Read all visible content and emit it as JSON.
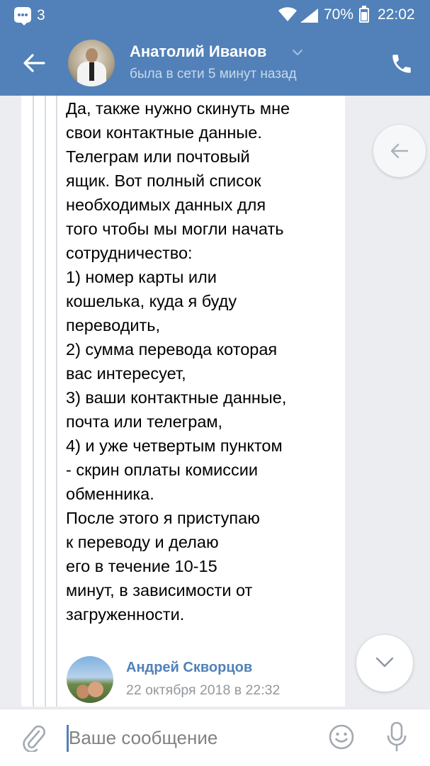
{
  "status_bar": {
    "notification_count": "3",
    "battery": "70%",
    "time": "22:02"
  },
  "header": {
    "contact_name": "Анатолий Иванов",
    "contact_status": "была в сети 5 минут назад"
  },
  "message": {
    "lines": [
      "Да, также нужно скинуть мне",
      "свои контактные данные.",
      "Телеграм или почтовый",
      "ящик. Вот полный список",
      "необходимых данных для",
      "того чтобы мы могли начать",
      "сотрудничество:",
      "1) номер карты или",
      "кошелька, куда я буду",
      "переводить,",
      "2) сумма перевода которая",
      "вас интересует,",
      "3) ваши контактные данные,",
      "почта или телеграм,",
      "4) и уже четвертым пунктом",
      "- скрин оплаты комиссии",
      "обменника.",
      "После этого я приступаю",
      "к переводу и делаю",
      "его в течение 10-15",
      "минут, в зависимости от",
      "загруженности."
    ],
    "forwarded_sender": "Андрей Скворцов",
    "forwarded_date": "22 октября 2018 в 22:32"
  },
  "composer": {
    "placeholder": "Ваше сообщение"
  },
  "colors": {
    "brand": "#5181b8",
    "background": "#ebedf0"
  },
  "icons": [
    "message-notification-icon",
    "wifi-icon",
    "signal-icon",
    "battery-icon",
    "back-arrow-icon",
    "chevron-down-icon",
    "phone-icon",
    "scroll-back-icon",
    "scroll-down-icon",
    "paperclip-icon",
    "emoji-icon",
    "microphone-icon"
  ]
}
